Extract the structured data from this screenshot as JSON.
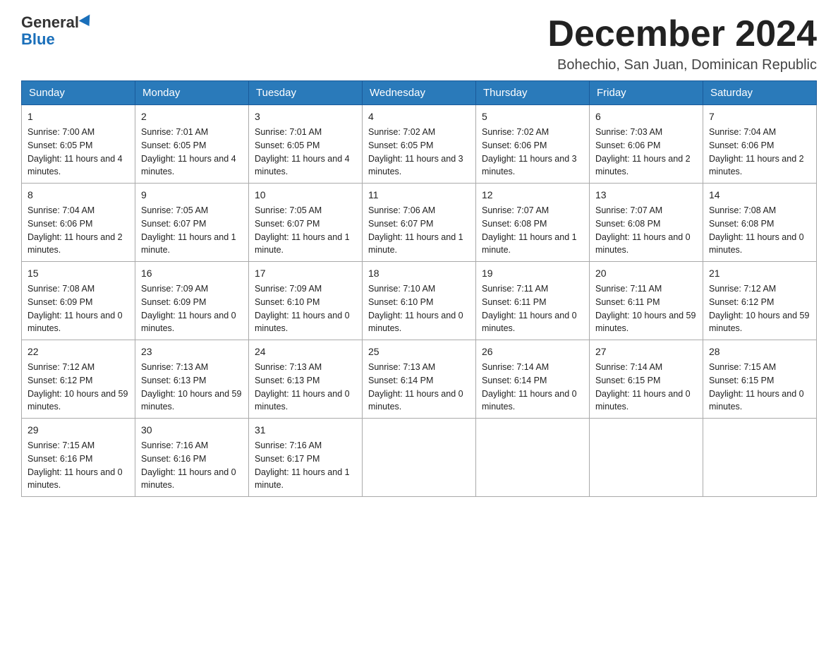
{
  "header": {
    "logo_general": "General",
    "logo_blue": "Blue",
    "month_title": "December 2024",
    "location": "Bohechio, San Juan, Dominican Republic"
  },
  "days_of_week": [
    "Sunday",
    "Monday",
    "Tuesday",
    "Wednesday",
    "Thursday",
    "Friday",
    "Saturday"
  ],
  "weeks": [
    [
      {
        "date": "1",
        "sunrise": "7:00 AM",
        "sunset": "6:05 PM",
        "daylight": "11 hours and 4 minutes."
      },
      {
        "date": "2",
        "sunrise": "7:01 AM",
        "sunset": "6:05 PM",
        "daylight": "11 hours and 4 minutes."
      },
      {
        "date": "3",
        "sunrise": "7:01 AM",
        "sunset": "6:05 PM",
        "daylight": "11 hours and 4 minutes."
      },
      {
        "date": "4",
        "sunrise": "7:02 AM",
        "sunset": "6:05 PM",
        "daylight": "11 hours and 3 minutes."
      },
      {
        "date": "5",
        "sunrise": "7:02 AM",
        "sunset": "6:06 PM",
        "daylight": "11 hours and 3 minutes."
      },
      {
        "date": "6",
        "sunrise": "7:03 AM",
        "sunset": "6:06 PM",
        "daylight": "11 hours and 2 minutes."
      },
      {
        "date": "7",
        "sunrise": "7:04 AM",
        "sunset": "6:06 PM",
        "daylight": "11 hours and 2 minutes."
      }
    ],
    [
      {
        "date": "8",
        "sunrise": "7:04 AM",
        "sunset": "6:06 PM",
        "daylight": "11 hours and 2 minutes."
      },
      {
        "date": "9",
        "sunrise": "7:05 AM",
        "sunset": "6:07 PM",
        "daylight": "11 hours and 1 minute."
      },
      {
        "date": "10",
        "sunrise": "7:05 AM",
        "sunset": "6:07 PM",
        "daylight": "11 hours and 1 minute."
      },
      {
        "date": "11",
        "sunrise": "7:06 AM",
        "sunset": "6:07 PM",
        "daylight": "11 hours and 1 minute."
      },
      {
        "date": "12",
        "sunrise": "7:07 AM",
        "sunset": "6:08 PM",
        "daylight": "11 hours and 1 minute."
      },
      {
        "date": "13",
        "sunrise": "7:07 AM",
        "sunset": "6:08 PM",
        "daylight": "11 hours and 0 minutes."
      },
      {
        "date": "14",
        "sunrise": "7:08 AM",
        "sunset": "6:08 PM",
        "daylight": "11 hours and 0 minutes."
      }
    ],
    [
      {
        "date": "15",
        "sunrise": "7:08 AM",
        "sunset": "6:09 PM",
        "daylight": "11 hours and 0 minutes."
      },
      {
        "date": "16",
        "sunrise": "7:09 AM",
        "sunset": "6:09 PM",
        "daylight": "11 hours and 0 minutes."
      },
      {
        "date": "17",
        "sunrise": "7:09 AM",
        "sunset": "6:10 PM",
        "daylight": "11 hours and 0 minutes."
      },
      {
        "date": "18",
        "sunrise": "7:10 AM",
        "sunset": "6:10 PM",
        "daylight": "11 hours and 0 minutes."
      },
      {
        "date": "19",
        "sunrise": "7:11 AM",
        "sunset": "6:11 PM",
        "daylight": "11 hours and 0 minutes."
      },
      {
        "date": "20",
        "sunrise": "7:11 AM",
        "sunset": "6:11 PM",
        "daylight": "10 hours and 59 minutes."
      },
      {
        "date": "21",
        "sunrise": "7:12 AM",
        "sunset": "6:12 PM",
        "daylight": "10 hours and 59 minutes."
      }
    ],
    [
      {
        "date": "22",
        "sunrise": "7:12 AM",
        "sunset": "6:12 PM",
        "daylight": "10 hours and 59 minutes."
      },
      {
        "date": "23",
        "sunrise": "7:13 AM",
        "sunset": "6:13 PM",
        "daylight": "10 hours and 59 minutes."
      },
      {
        "date": "24",
        "sunrise": "7:13 AM",
        "sunset": "6:13 PM",
        "daylight": "11 hours and 0 minutes."
      },
      {
        "date": "25",
        "sunrise": "7:13 AM",
        "sunset": "6:14 PM",
        "daylight": "11 hours and 0 minutes."
      },
      {
        "date": "26",
        "sunrise": "7:14 AM",
        "sunset": "6:14 PM",
        "daylight": "11 hours and 0 minutes."
      },
      {
        "date": "27",
        "sunrise": "7:14 AM",
        "sunset": "6:15 PM",
        "daylight": "11 hours and 0 minutes."
      },
      {
        "date": "28",
        "sunrise": "7:15 AM",
        "sunset": "6:15 PM",
        "daylight": "11 hours and 0 minutes."
      }
    ],
    [
      {
        "date": "29",
        "sunrise": "7:15 AM",
        "sunset": "6:16 PM",
        "daylight": "11 hours and 0 minutes."
      },
      {
        "date": "30",
        "sunrise": "7:16 AM",
        "sunset": "6:16 PM",
        "daylight": "11 hours and 0 minutes."
      },
      {
        "date": "31",
        "sunrise": "7:16 AM",
        "sunset": "6:17 PM",
        "daylight": "11 hours and 1 minute."
      },
      null,
      null,
      null,
      null
    ]
  ]
}
